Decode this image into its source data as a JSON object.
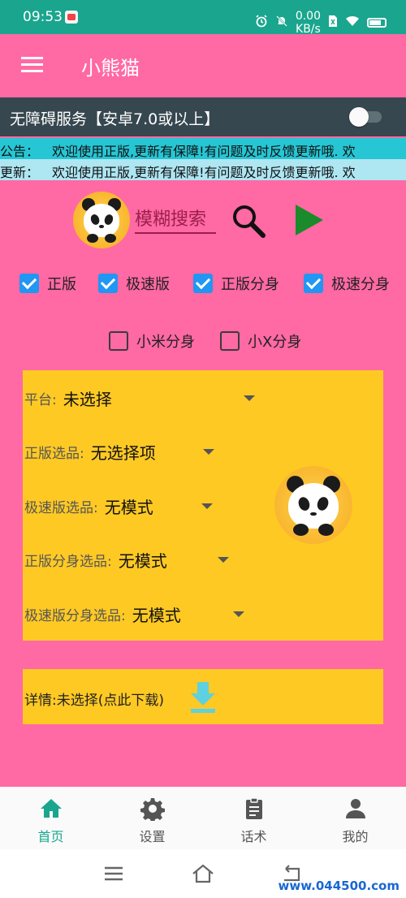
{
  "status_bar": {
    "time": "09:53",
    "net_speed_value": "0.00",
    "net_speed_unit": "KB/s",
    "icons": [
      "alarm-icon",
      "mute-icon",
      "net-speed-icon",
      "sim-icon",
      "wifi-icon",
      "battery-icon"
    ]
  },
  "app_bar": {
    "title": "小熊猫",
    "menu_icon": "menu-icon"
  },
  "accessibility": {
    "label": "无障碍服务【安卓7.0或以上】",
    "enabled": false
  },
  "notice": {
    "prefix": "公告：",
    "text": "欢迎使用正版,更新有保障!有问题及时反馈更新哦. 欢"
  },
  "update": {
    "prefix": "更新：",
    "text": "欢迎使用正版,更新有保障!有问题及时反馈更新哦. 欢"
  },
  "search": {
    "placeholder": "模糊搜索"
  },
  "checkboxes_row1": [
    {
      "label": "正版",
      "checked": true
    },
    {
      "label": "极速版",
      "checked": true
    },
    {
      "label": "正版分身",
      "checked": true
    },
    {
      "label": "极速分身",
      "checked": true
    }
  ],
  "checkboxes_row2": [
    {
      "label": "小米分身",
      "checked": false
    },
    {
      "label": "小X分身",
      "checked": false
    }
  ],
  "options": [
    {
      "label": "平台:",
      "value": "未选择"
    },
    {
      "label": "正版选品:",
      "value": "无选择项"
    },
    {
      "label": "极速版选品:",
      "value": "无模式"
    },
    {
      "label": "正版分身选品:",
      "value": "无模式"
    },
    {
      "label": "极速版分身选品:",
      "value": "无模式"
    }
  ],
  "details": {
    "label": "详情:",
    "value": "未选择(点此下载)"
  },
  "bottom_nav": [
    {
      "label": "首页",
      "icon": "home-icon",
      "active": true
    },
    {
      "label": "设置",
      "icon": "gear-icon",
      "active": false
    },
    {
      "label": "话术",
      "icon": "clipboard-icon",
      "active": false
    },
    {
      "label": "我的",
      "icon": "person-icon",
      "active": false
    }
  ],
  "watermark": "www.044500.com",
  "colors": {
    "status_bar": "#1aa58e",
    "background": "#ff69a4",
    "accessibility_bar": "#36474f",
    "notice_bar": "#27c6d4",
    "update_bar": "#aee6f2",
    "checkbox": "#2196f3",
    "panel": "#ffc924",
    "play": "#1b8a2a",
    "active_nav": "#1aa58e"
  }
}
